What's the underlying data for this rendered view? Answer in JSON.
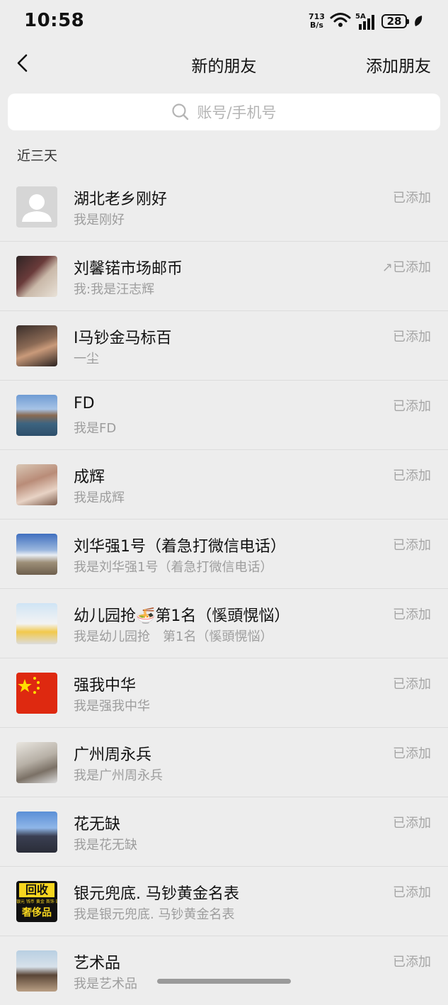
{
  "status_bar": {
    "time": "10:58",
    "net_speed_top": "713",
    "net_speed_bottom": "B/s",
    "signal_label": "5A",
    "battery": "28"
  },
  "nav": {
    "title": "新的朋友",
    "add_friend": "添加朋友"
  },
  "search": {
    "placeholder": "账号/手机号",
    "icon": "search-icon"
  },
  "section_label": "近三天",
  "friends": [
    {
      "name": "湖北老乡刚好",
      "sub": "我是刚好",
      "status": "已添加"
    },
    {
      "name": "刘馨锘市场邮币",
      "sub": "我:我是汪志辉",
      "status": "↗已添加"
    },
    {
      "name": "I马钞金马标百",
      "sub": "一尘",
      "status": "已添加"
    },
    {
      "name": "FD",
      "sub": "我是FD",
      "status": "已添加"
    },
    {
      "name": "成辉",
      "sub": "我是成辉",
      "status": "已添加"
    },
    {
      "name": "刘华强1号（着急打微信电话）",
      "sub": "我是刘华强1号（着急打微信电话）",
      "status": "已添加"
    },
    {
      "name": "幼儿园抢🍜第1名（慀頭愰悩）",
      "sub": "我是幼儿园抢　第1名（慀頭愰悩）",
      "status": "已添加"
    },
    {
      "name": "强我中华",
      "sub": "我是强我中华",
      "status": "已添加"
    },
    {
      "name": "广州周永兵",
      "sub": "我是广州周永兵",
      "status": "已添加"
    },
    {
      "name": "花无缺",
      "sub": "我是花无缺",
      "status": "已添加"
    },
    {
      "name": "银元兜底. 马钞黄金名表",
      "sub": "我是银元兜底. 马钞黄金名表",
      "status": "已添加"
    },
    {
      "name": "艺术品",
      "sub": "我是艺术品",
      "status": "已添加"
    }
  ],
  "recycle_avatar": {
    "top": "回收",
    "mid": "银元 钱币 黄金 首饰 珠宝",
    "bottom": "奢侈品"
  }
}
